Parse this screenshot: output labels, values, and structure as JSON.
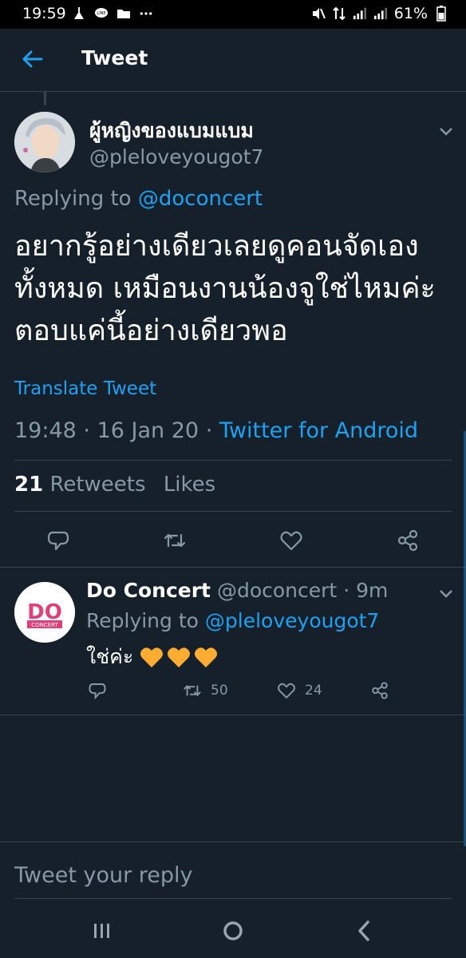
{
  "status_bar": {
    "time": "19:59",
    "battery": "61%"
  },
  "header": {
    "title": "Tweet"
  },
  "tweet": {
    "display_name": "ผู้หญิงของแบมแบม",
    "handle": "@pleloveyougot7",
    "replying_prefix": "Replying to",
    "replying_to": "@doconcert",
    "text": "อยากรู้อย่างเดียวเลยดูคอนจัดเองทั้งหมด เหมือนงานน้องจูใช่ไหมค่ะ ตอบแค่นี้อย่างเดียวพอ",
    "translate_label": "Translate Tweet",
    "time": "19:48",
    "date": "16 Jan 20",
    "source": "Twitter for Android",
    "retweet_count": "21",
    "retweets_label": "Retweets",
    "likes_label": "Likes"
  },
  "reply": {
    "display_name": "Do Concert",
    "handle": "@doconcert",
    "time_ago": "9m",
    "replying_prefix": "Replying to",
    "replying_to": "@pleloveyougot7",
    "text": "ใช่ค่ะ",
    "retweet_count": "50",
    "like_count": "24",
    "logo_text": "DO",
    "logo_subtext": "CONCERT"
  },
  "composer": {
    "placeholder": "Tweet your reply"
  },
  "colors": {
    "background": "#15202b",
    "accent": "#1da1f2",
    "muted": "#8899a6",
    "heart": "#ffac33",
    "logo": "#e0407a"
  }
}
